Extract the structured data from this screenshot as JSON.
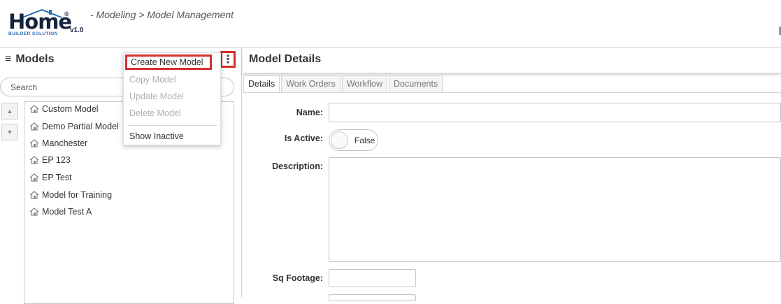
{
  "header": {
    "logo": {
      "word": "Home",
      "registered": "®",
      "subtitle": "BUILDER SOLUTION",
      "version": "v1.0"
    },
    "breadcrumb": "- Modeling > Model Management"
  },
  "left_panel": {
    "menu_glyph": "≡",
    "title": "Models",
    "kebab_glyph": "⋮",
    "search_placeholder": "Search",
    "up_arrow": "▲",
    "down_arrow": "▼",
    "models": [
      "Custom Model",
      "Demo Partial Model",
      "Manchester",
      "EP 123",
      "EP Test",
      "Model for Training",
      "Model Test A"
    ]
  },
  "context_menu": {
    "items": [
      {
        "label": "Create New Model",
        "enabled": true,
        "highlighted": true
      },
      {
        "label": "Copy Model",
        "enabled": false
      },
      {
        "label": "Update Model",
        "enabled": false
      },
      {
        "label": "Delete Model",
        "enabled": false
      },
      {
        "label": "Show Inactive",
        "enabled": true
      }
    ]
  },
  "details": {
    "title": "Model Details",
    "tabs": [
      "Details",
      "Work Orders",
      "Workflow",
      "Documents"
    ],
    "active_tab": "Details",
    "fields": {
      "name_label": "Name:",
      "is_active_label": "Is Active:",
      "is_active_value": "False",
      "description_label": "Description:",
      "sq_footage_label": "Sq Footage:"
    }
  },
  "colors": {
    "highlight": "#d32f2f",
    "logo_navy": "#15233f",
    "logo_blue": "#2b6cb0"
  }
}
